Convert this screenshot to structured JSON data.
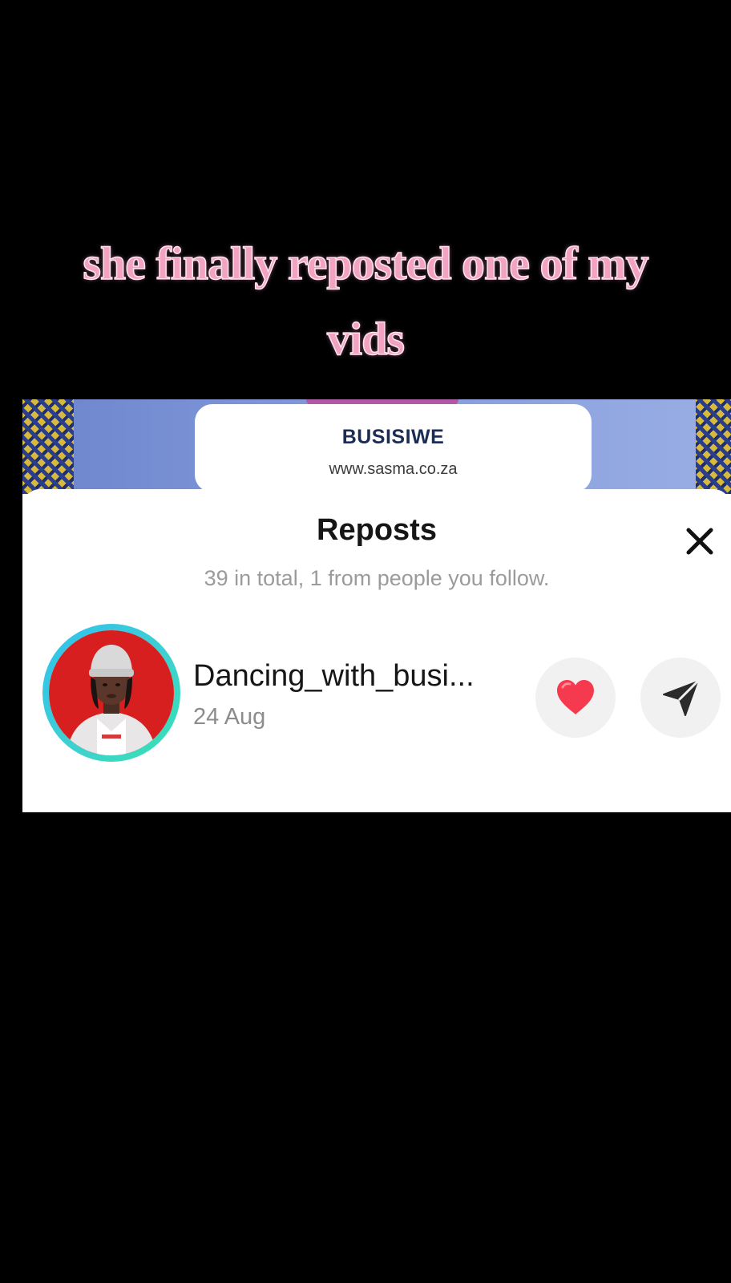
{
  "caption": {
    "line1": "she finally reposted one of my",
    "line2": "vids"
  },
  "banner": {
    "title": "BUSISIWE",
    "url": "www.sasma.co.za"
  },
  "sheet": {
    "title": "Reposts",
    "subtitle": "39 in total, 1 from people you follow.",
    "close_icon": "close-icon"
  },
  "repost": {
    "username": "Dancing_with_busi...",
    "date": "24 Aug",
    "like_icon": "heart-icon",
    "share_icon": "send-icon"
  },
  "colors": {
    "caption": "#f2a3c2",
    "heart": "#f53a4f",
    "avatar_ring_start": "#2fc1ef",
    "avatar_ring_end": "#34e3b0",
    "avatar_bg": "#d81f1f"
  }
}
